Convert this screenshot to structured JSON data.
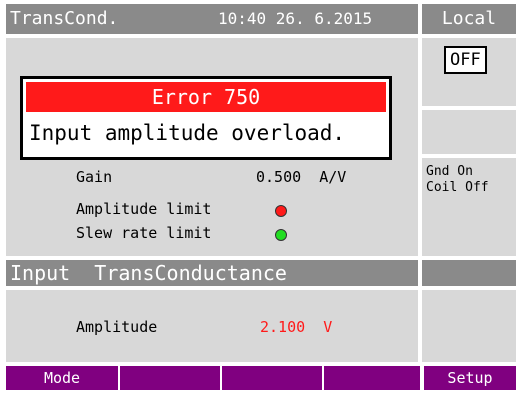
{
  "header": {
    "title": "TransCond.",
    "clock": "10:40  26. 6.2015",
    "mode_indicator": "Local"
  },
  "side_keys": {
    "output_toggle": "OFF",
    "status": "Gnd On\nCoil Off"
  },
  "error": {
    "title": "Error 750",
    "message": "Input amplitude overload."
  },
  "parameters": {
    "gain_label": "Gain",
    "gain_value": "0.500  A/V",
    "amplitude_limit_label": "Amplitude limit",
    "slew_rate_limit_label": "Slew rate limit",
    "amplitude_limit_led": "#ff1a1a",
    "slew_rate_limit_led": "#22dd22"
  },
  "section": {
    "title": "Input  TransConductance"
  },
  "input": {
    "amplitude_label": "Amplitude",
    "amplitude_value": "2.100  V"
  },
  "softkeys": [
    "Mode",
    "",
    "",
    "",
    "Setup"
  ],
  "colors": {
    "header_bg": "#8a8a8a",
    "panel_bg": "#d8d8d8",
    "softkey_bg": "#800080",
    "error_bg": "#ff1a1a"
  }
}
